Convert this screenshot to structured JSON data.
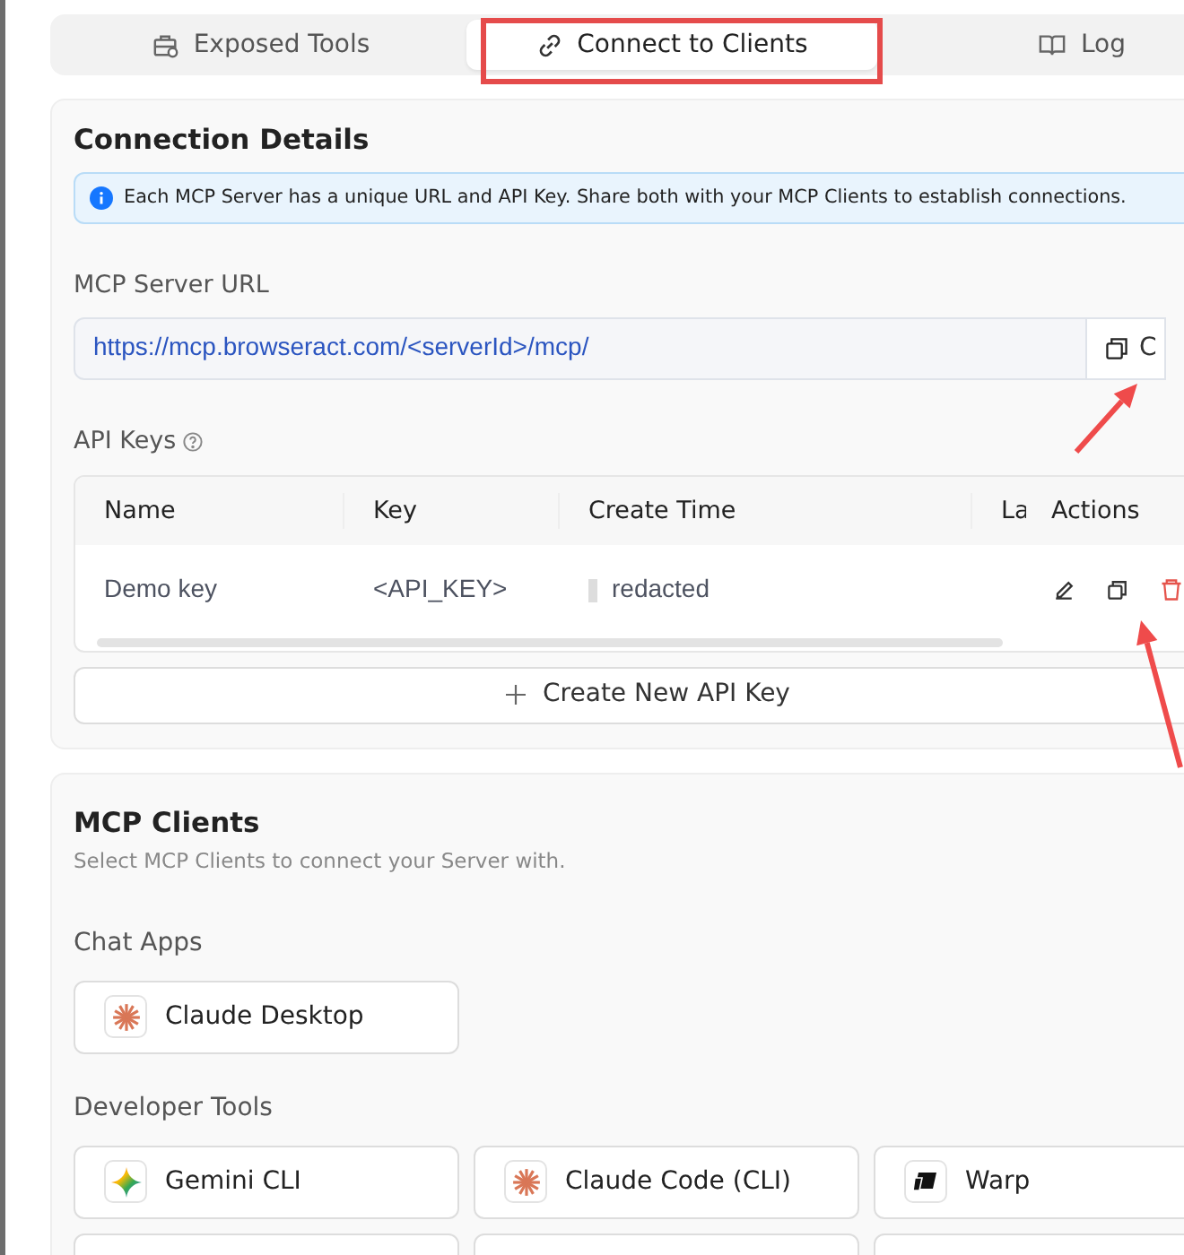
{
  "tabs": [
    {
      "label": "Exposed Tools",
      "kind": "toolbox",
      "selected": false
    },
    {
      "label": "Connect to Clients",
      "kind": "link",
      "selected": true
    },
    {
      "label": "Log",
      "kind": "book",
      "selected": false
    }
  ],
  "connection_details": {
    "title": "Connection Details",
    "info": "Each MCP Server has a unique URL and API Key. Share both with your MCP Clients to establish connections.",
    "url_label": "MCP Server URL",
    "url_value": "https://mcp.browseract.com/<serverId>/mcp/",
    "copy_button": "C",
    "api_keys_label": "API Keys",
    "table": {
      "columns": [
        "Name",
        "Key",
        "Create Time",
        "La",
        "Actions"
      ],
      "rows": [
        {
          "name": "Demo key",
          "key": "<API_KEY>",
          "create_time": "redacted"
        }
      ]
    },
    "create_button": "Create New API Key"
  },
  "mcp_clients": {
    "title": "MCP Clients",
    "subtitle": "Select MCP Clients to connect your Server with.",
    "groups": [
      {
        "title": "Chat Apps",
        "items": [
          {
            "label": "Claude Desktop",
            "kind": "claude"
          }
        ]
      },
      {
        "title": "Developer Tools",
        "items": [
          {
            "label": "Gemini CLI",
            "kind": "gemini"
          },
          {
            "label": "Claude Code (CLI)",
            "kind": "claude"
          },
          {
            "label": "Warp",
            "kind": "warp"
          }
        ]
      }
    ]
  }
}
